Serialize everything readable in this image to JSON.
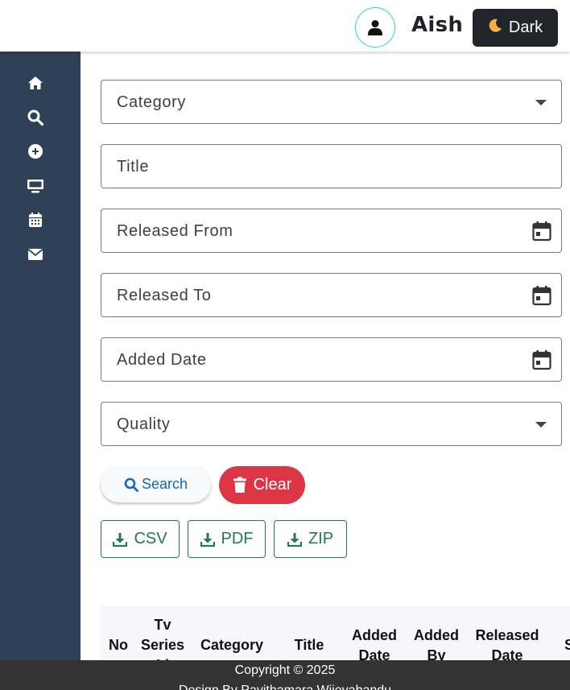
{
  "header": {
    "username": "Aish",
    "theme_toggle_label": "Dark",
    "accent_border": "#22d3ee"
  },
  "sidebar": {
    "background": "#2f4157",
    "items": [
      {
        "icon": "home-icon"
      },
      {
        "icon": "search-icon"
      },
      {
        "icon": "plus-circle-icon"
      },
      {
        "icon": "tv-icon"
      },
      {
        "icon": "calendar-icon"
      },
      {
        "icon": "envelope-icon"
      }
    ]
  },
  "filters": {
    "category_label": "Category",
    "title_label": "Title",
    "released_from_label": "Released From",
    "released_to_label": "Released To",
    "added_date_label": "Added Date",
    "quality_label": "Quality"
  },
  "actions": {
    "search_label": "Search",
    "clear_label": "Clear",
    "csv_label": "CSV",
    "pdf_label": "PDF",
    "zip_label": "ZIP"
  },
  "table": {
    "headers": [
      "No",
      "Tv Series Id",
      "Category",
      "Title",
      "Added Date",
      "Added By",
      "Released Date",
      "S"
    ]
  },
  "footer": {
    "copyright": "Copyright © 2025",
    "design_by": "Design By Pavithamara Wijeyabandu"
  },
  "colors": {
    "danger": "#dc3545",
    "success": "#1f7a4d",
    "primary": "#1565c0",
    "dark": "#212529"
  }
}
